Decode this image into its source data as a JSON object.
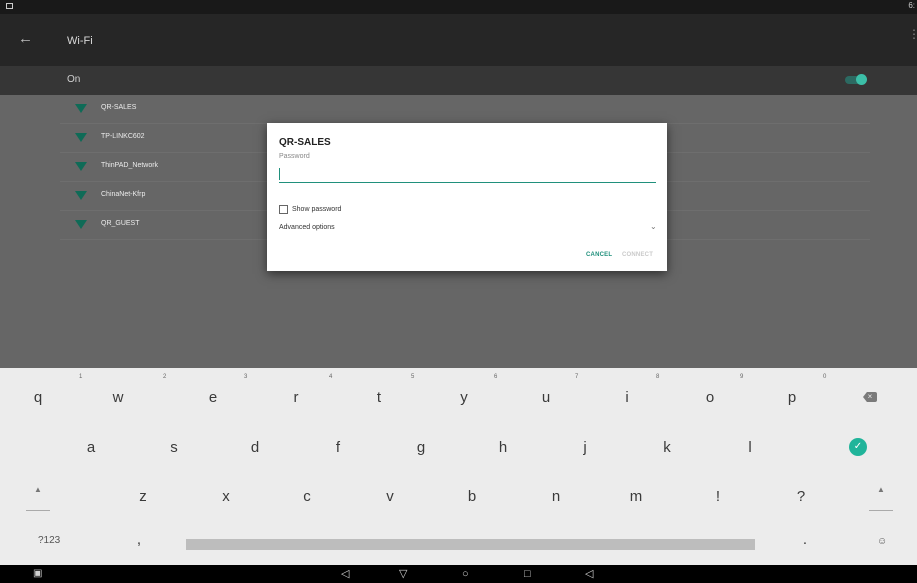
{
  "status_bar": {
    "time": "6:"
  },
  "app_bar": {
    "title": "Wi-Fi",
    "back_icon": "arrow-left-icon",
    "more_icon": "overflow-menu-icon"
  },
  "wifi_switch": {
    "label": "On",
    "enabled": true,
    "accent": "#3cbfa8"
  },
  "networks": [
    {
      "name": "QR-SALES"
    },
    {
      "name": "TP-LINKC602"
    },
    {
      "name": "ThinPAD_Network"
    },
    {
      "name": "ChinaNet-Kfrp"
    },
    {
      "name": "QR_GUEST"
    }
  ],
  "dialog": {
    "title": "QR-SALES",
    "password_label": "Password",
    "password_value": "",
    "show_password_label": "Show password",
    "show_password_checked": false,
    "advanced_label": "Advanced options",
    "cancel_label": "CANCEL",
    "connect_label": "CONNECT",
    "accent": "#20907c"
  },
  "keyboard": {
    "row1": [
      "q",
      "w",
      "e",
      "r",
      "t",
      "y",
      "u",
      "i",
      "o",
      "p"
    ],
    "row1_hints": [
      "1",
      "2",
      "3",
      "4",
      "5",
      "6",
      "7",
      "8",
      "9",
      "0"
    ],
    "row2": [
      "a",
      "s",
      "d",
      "f",
      "g",
      "h",
      "j",
      "k",
      "l"
    ],
    "row3": [
      "z",
      "x",
      "c",
      "v",
      "b",
      "n",
      "m",
      "!",
      "?"
    ],
    "symbols_label": "?123",
    "comma_label": ",",
    "period_label": ".",
    "enter_icon": "check-circle-icon",
    "backspace_icon": "backspace-icon",
    "shift_icon": "shift-arrow-icon",
    "emoji_icon": "emoji-icon"
  },
  "nav_bar": {
    "screenshot_icon": "screenshot-icon",
    "volume_down_icon": "volume-down-icon",
    "back_icon": "nav-back-triangle-icon",
    "home_icon": "nav-home-circle-icon",
    "recents_icon": "nav-recents-square-icon",
    "volume_up_icon": "volume-up-icon"
  }
}
